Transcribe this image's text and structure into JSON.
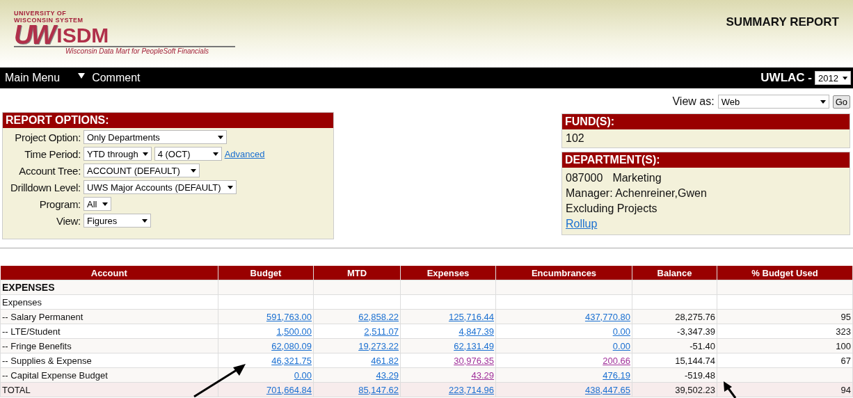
{
  "header": {
    "logo": {
      "line_1": "UNIVERSITY OF",
      "line_2": "WISCONSIN SYSTEM",
      "mark": "UW",
      "wordmark": "ISDM",
      "tagline": "Wisconsin Data Mart for PeopleSoft Financials"
    },
    "page_title": "SUMMARY REPORT"
  },
  "nav": {
    "items": [
      "Main Menu",
      "Comment"
    ],
    "campus": "UWLAC -",
    "year": "2012"
  },
  "view_as": {
    "label": "View as:",
    "value": "Web",
    "button": "Go"
  },
  "report_options": {
    "title": "REPORT OPTIONS:",
    "fields": [
      {
        "label": "Project Option:",
        "controls": [
          {
            "kind": "select",
            "value": "Only Departments"
          }
        ]
      },
      {
        "label": "Time Period:",
        "controls": [
          {
            "kind": "select",
            "value": "YTD through"
          },
          {
            "kind": "select",
            "value": "4 (OCT)"
          },
          {
            "kind": "link",
            "value": "Advanced"
          }
        ]
      },
      {
        "label": "Account Tree:",
        "controls": [
          {
            "kind": "select",
            "value": "ACCOUNT (DEFAULT)"
          }
        ]
      },
      {
        "label": "Drilldown Level:",
        "controls": [
          {
            "kind": "select",
            "value": "UWS Major Accounts (DEFAULT)"
          }
        ]
      },
      {
        "label": "Program:",
        "controls": [
          {
            "kind": "select",
            "value": "All"
          }
        ]
      },
      {
        "label": "View:",
        "controls": [
          {
            "kind": "select",
            "value": "Figures"
          }
        ]
      }
    ]
  },
  "fund": {
    "title": "FUND(S):",
    "value": "102"
  },
  "department": {
    "title": "DEPARTMENT(S):",
    "code": "087000",
    "name": "Marketing",
    "lines": [
      "Manager: Achenreiner,Gwen",
      "Excluding Projects"
    ],
    "link": "Rollup"
  },
  "table": {
    "columns": [
      "Account",
      "Budget",
      "MTD",
      "Expenses",
      "Encumbrances",
      "Balance",
      "% Budget Used"
    ],
    "rows": [
      {
        "kind": "section",
        "cells": [
          {
            "kind": "text",
            "text": "EXPENSES"
          }
        ]
      },
      {
        "kind": "group",
        "cells": [
          {
            "kind": "text",
            "text": "Expenses"
          }
        ]
      },
      {
        "kind": "line",
        "cells": [
          {
            "kind": "text",
            "text": "-- Salary Permanent"
          },
          {
            "kind": "link",
            "text": "591,763.00",
            "visited": false
          },
          {
            "kind": "link",
            "text": "62,858.22",
            "visited": false
          },
          {
            "kind": "link",
            "text": "125,716.44",
            "visited": false
          },
          {
            "kind": "link",
            "text": "437,770.80",
            "visited": false
          },
          {
            "kind": "text",
            "text": "28,275.76"
          },
          {
            "kind": "text",
            "text": "95"
          }
        ]
      },
      {
        "kind": "line",
        "cells": [
          {
            "kind": "text",
            "text": "-- LTE/Student"
          },
          {
            "kind": "link",
            "text": "1,500.00",
            "visited": false
          },
          {
            "kind": "link",
            "text": "2,511.07",
            "visited": false
          },
          {
            "kind": "link",
            "text": "4,847.39",
            "visited": false
          },
          {
            "kind": "link",
            "text": "0.00",
            "visited": false
          },
          {
            "kind": "text",
            "text": "-3,347.39"
          },
          {
            "kind": "text",
            "text": "323"
          }
        ]
      },
      {
        "kind": "line",
        "cells": [
          {
            "kind": "text",
            "text": "-- Fringe Benefits"
          },
          {
            "kind": "link",
            "text": "62,080.09",
            "visited": false
          },
          {
            "kind": "link",
            "text": "19,273.22",
            "visited": false
          },
          {
            "kind": "link",
            "text": "62,131.49",
            "visited": false
          },
          {
            "kind": "link",
            "text": "0.00",
            "visited": false
          },
          {
            "kind": "text",
            "text": "-51.40"
          },
          {
            "kind": "text",
            "text": "100"
          }
        ]
      },
      {
        "kind": "line",
        "cells": [
          {
            "kind": "text",
            "text": "-- Supplies & Expense"
          },
          {
            "kind": "link",
            "text": "46,321.75",
            "visited": false
          },
          {
            "kind": "link",
            "text": "461.82",
            "visited": false
          },
          {
            "kind": "link",
            "text": "30,976.35",
            "visited": true
          },
          {
            "kind": "link",
            "text": "200.66",
            "visited": true
          },
          {
            "kind": "text",
            "text": "15,144.74"
          },
          {
            "kind": "text",
            "text": "67"
          }
        ]
      },
      {
        "kind": "line",
        "cells": [
          {
            "kind": "text",
            "text": "-- Capital Expense Budget"
          },
          {
            "kind": "link",
            "text": "0.00",
            "visited": false
          },
          {
            "kind": "link",
            "text": "43.29",
            "visited": false
          },
          {
            "kind": "link",
            "text": "43.29",
            "visited": true
          },
          {
            "kind": "link",
            "text": "476.19",
            "visited": false
          },
          {
            "kind": "text",
            "text": "-519.48"
          }
        ]
      },
      {
        "kind": "total",
        "cells": [
          {
            "kind": "text",
            "text": "TOTAL"
          },
          {
            "kind": "link",
            "text": "701,664.84",
            "visited": false
          },
          {
            "kind": "link",
            "text": "85,147.62",
            "visited": false
          },
          {
            "kind": "link",
            "text": "223,714.96",
            "visited": false
          },
          {
            "kind": "link",
            "text": "438,447.65",
            "visited": false
          },
          {
            "kind": "text",
            "text": "39,502.23"
          },
          {
            "kind": "text",
            "text": "94"
          }
        ]
      }
    ]
  }
}
